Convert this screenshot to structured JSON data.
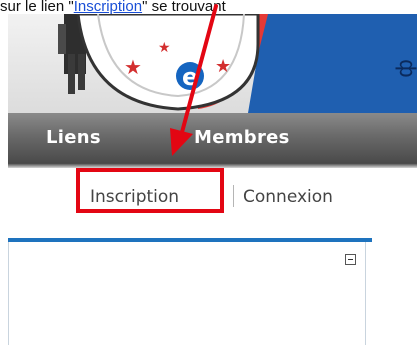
{
  "caption": {
    "before": "sur le lien \"",
    "link": "Inscription",
    "after": "\" se trouvant"
  },
  "banner": {
    "logo_letter": "e",
    "side_text": "ф"
  },
  "nav": {
    "items": [
      "Liens",
      "Membres"
    ]
  },
  "auth": {
    "register": "Inscription",
    "login": "Connexion"
  },
  "colors": {
    "annotation": "#e30613",
    "accent_line": "#1e73be",
    "link": "#1a4fd6"
  },
  "icons": {
    "collapse": "minus-box-icon",
    "annotation_arrow": "red-arrow"
  }
}
